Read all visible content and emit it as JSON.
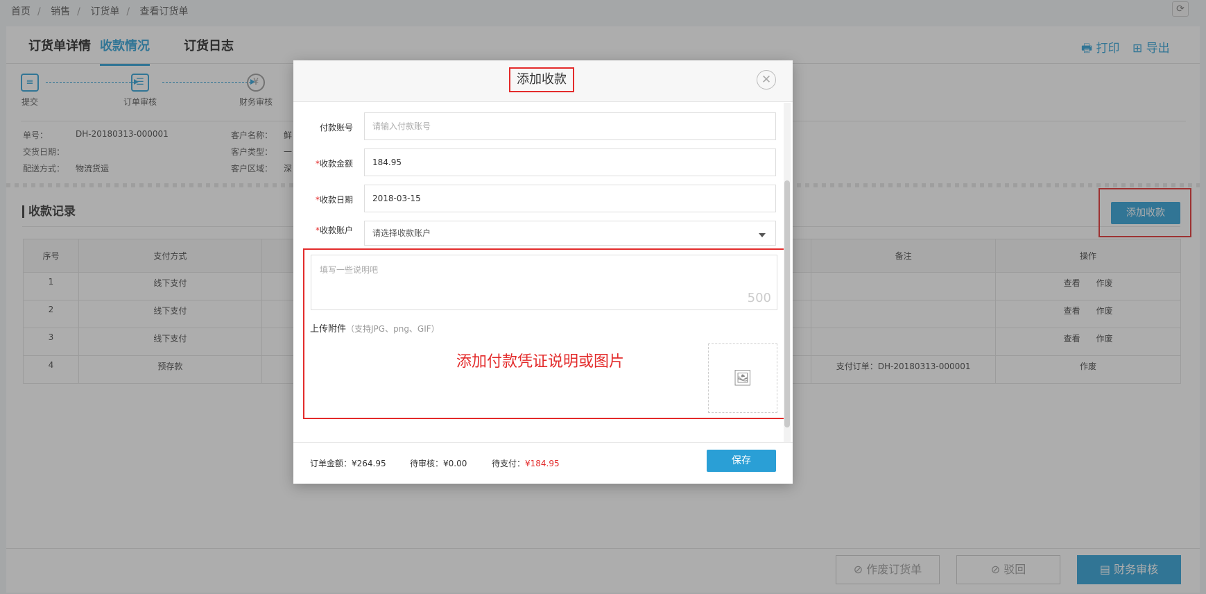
{
  "breadcrumb": [
    "首页",
    "销售",
    "订货单",
    "查看订货单"
  ],
  "tabs": [
    "订货单详情",
    "收款情况",
    "订货日志"
  ],
  "actions": {
    "print": "打印",
    "export": "导出"
  },
  "steps": [
    "提交",
    "订单审核",
    "财务审核"
  ],
  "order_info": {
    "order_no_label": "单号：",
    "order_no": "DH-20180313-000001",
    "delivery_date_label": "交货日期：",
    "delivery_date": "",
    "shipping_label": "配送方式：",
    "shipping": "物流货运",
    "customer_name_label": "客户名称：",
    "customer_name": "鲜",
    "customer_type_label": "客户类型：",
    "customer_type": "一",
    "customer_region_label": "客户区域：",
    "customer_region": "深"
  },
  "records": {
    "title": "收款记录",
    "add_button": "添加收款",
    "headers": [
      "序号",
      "支付方式",
      "",
      "",
      "",
      "备注",
      "操作"
    ],
    "rows": [
      {
        "no": "1",
        "method": "线下支付",
        "remark": "",
        "ops": [
          "查看",
          "作废"
        ]
      },
      {
        "no": "2",
        "method": "线下支付",
        "remark": "",
        "ops": [
          "查看",
          "作废"
        ]
      },
      {
        "no": "3",
        "method": "线下支付",
        "remark": "",
        "ops": [
          "查看",
          "作废"
        ]
      },
      {
        "no": "4",
        "method": "预存款",
        "remark": "支付订单：DH-20180313-000001",
        "ops": [
          "作废"
        ]
      }
    ]
  },
  "bottom_buttons": {
    "void_order": "作废订货单",
    "reject": "驳回",
    "finance_review": "财务审核"
  },
  "modal": {
    "title": "添加收款",
    "payment_account_label": "付款账号",
    "payment_account_placeholder": "请输入付款账号",
    "amount_label": "收款金额",
    "amount": "184.95",
    "date_label": "收款日期",
    "date": "2018-03-15",
    "receive_account_label": "收款账户",
    "receive_account_placeholder": "请选择收款账户",
    "note_placeholder": "填写一些说明吧",
    "note_counter": "500",
    "upload_label": "上传附件",
    "upload_hint": "（支持JPG、png、GIF）",
    "annotation": "添加付款凭证说明或图片",
    "summary": {
      "order_amount_label": "订单金额：",
      "order_amount": "¥264.95",
      "pending_review_label": "待审核：",
      "pending_review": "¥0.00",
      "pending_pay_label": "待支付：",
      "pending_pay": "¥184.95"
    },
    "save_button": "保存"
  },
  "colors": {
    "accent": "#2a9fd6",
    "annotation_red": "#e32b2b"
  }
}
